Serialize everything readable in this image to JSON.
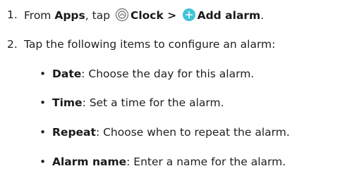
{
  "steps": [
    {
      "number": "1.",
      "text_1": "From ",
      "apps_label": "Apps",
      "text_2": ", tap ",
      "clock_icon": "clock-app-icon",
      "clock_label": "Clock",
      "separator": " > ",
      "add_icon": "add-circle-icon",
      "add_alarm_label": "Add alarm",
      "text_end": "."
    },
    {
      "number": "2.",
      "text": "Tap the following items to configure an alarm:"
    }
  ],
  "items": [
    {
      "bullet": "•",
      "term": "Date",
      "description": ": Choose the day for this alarm."
    },
    {
      "bullet": "•",
      "term": "Time",
      "description": ": Set a time for the alarm."
    },
    {
      "bullet": "•",
      "term": "Repeat",
      "description": ": Choose when to repeat the alarm."
    },
    {
      "bullet": "•",
      "term": "Alarm name",
      "description": ": Enter a name for the alarm."
    }
  ],
  "colors": {
    "add_icon_fill": "#3ec3d6",
    "clock_icon_stroke": "#6b6b6b",
    "text": "#1f1f1f"
  }
}
